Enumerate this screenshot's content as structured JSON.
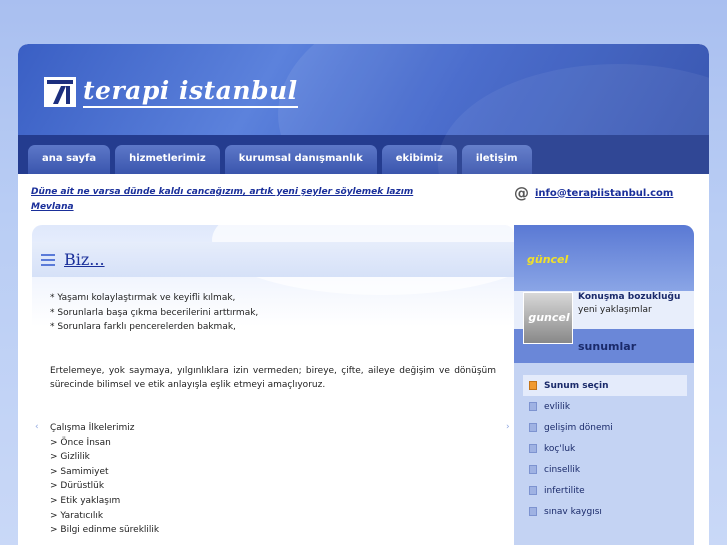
{
  "header": {
    "site_title": "terapi istanbul"
  },
  "nav": [
    {
      "label": "ana sayfa"
    },
    {
      "label": "hizmetlerimiz"
    },
    {
      "label": "kurumsal danışmanlık"
    },
    {
      "label": "ekibimiz"
    },
    {
      "label": "iletişim"
    }
  ],
  "quote": {
    "text": "Düne ait ne varsa dünde kaldı cancağızım, artık yeni şeyler söylemek lazım",
    "author": "Mevlana"
  },
  "contact": {
    "email": "info@terapiistanbul.com"
  },
  "content": {
    "title": "Biz...",
    "goals": [
      "* Yaşamı kolaylaştırmak ve keyifli kılmak,",
      "* Sorunlarla başa çıkma becerilerini arttırmak,",
      "* Sorunlara farklı pencerelerden bakmak,"
    ],
    "paragraph": "Ertelemeye, yok saymaya, yılgınlıklara izin vermeden; bireye, çifte, aileye değişim ve dönüşüm sürecinde bilimsel ve etik anlayışla eşlik etmeyi amaçlıyoruz.",
    "principles_title": "Çalışma İlkelerimiz",
    "principles": [
      "> Önce İnsan",
      "> Gizlilik",
      "> Samimiyet",
      "> Dürüstlük",
      "> Etik yaklaşım",
      "> Yaratıcılık",
      "> Bilgi edinme süreklilik"
    ]
  },
  "sidebar": {
    "heading": "güncel",
    "promo_thumb": "guncel",
    "promo_title": "Konuşma bozukluğu",
    "promo_sub": "yeni yaklaşımlar",
    "section": "sunumlar",
    "items": [
      {
        "label": "Sunum seçin"
      },
      {
        "label": "evlilik"
      },
      {
        "label": "gelişim dönemi"
      },
      {
        "label": "koç'luk"
      },
      {
        "label": "cinsellik"
      },
      {
        "label": "infertilite"
      },
      {
        "label": "sınav kaygısı"
      }
    ]
  },
  "colors": {
    "accent": "#1a2f9a",
    "nav_bg": "#243c8f",
    "highlight": "#f0e02a"
  }
}
